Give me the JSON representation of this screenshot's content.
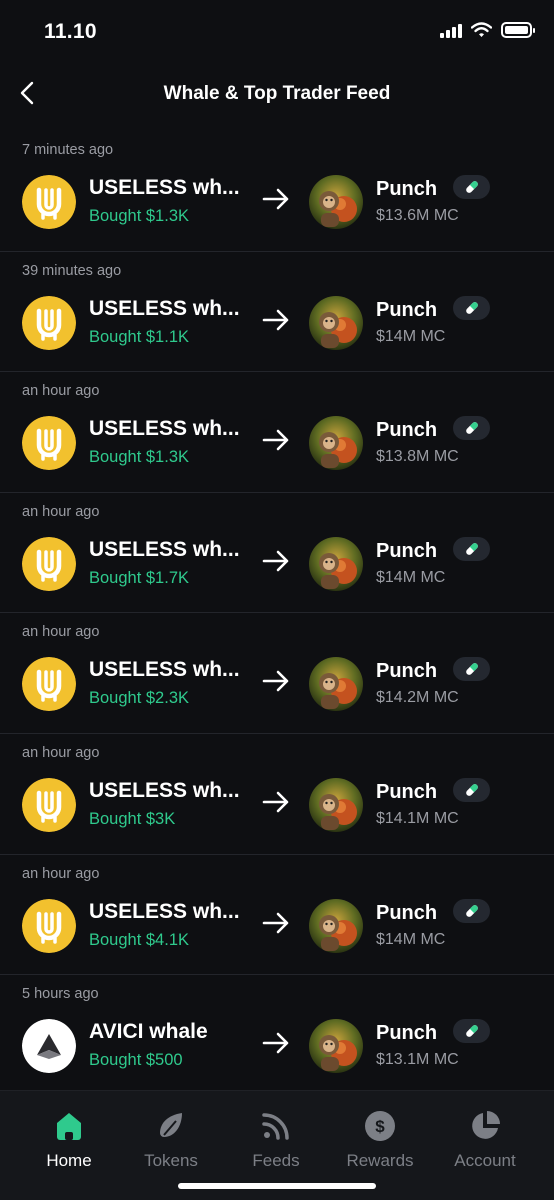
{
  "status_bar": {
    "time": "11.10"
  },
  "header": {
    "title": "Whale & Top Trader Feed"
  },
  "colors": {
    "accent_green": "#2fca8d",
    "useless_yellow": "#f2c12e",
    "background": "#0e0f12"
  },
  "feed": [
    {
      "time": "7 minutes ago",
      "trader": "USELESS wh...",
      "trader_icon": "useless-logo",
      "amount": "Bought $1.3K",
      "token": "Punch",
      "mc": "$13.6M MC"
    },
    {
      "time": "39 minutes ago",
      "trader": "USELESS wh...",
      "trader_icon": "useless-logo",
      "amount": "Bought $1.1K",
      "token": "Punch",
      "mc": "$14M MC"
    },
    {
      "time": "an hour ago",
      "trader": "USELESS wh...",
      "trader_icon": "useless-logo",
      "amount": "Bought $1.3K",
      "token": "Punch",
      "mc": "$13.8M MC"
    },
    {
      "time": "an hour ago",
      "trader": "USELESS wh...",
      "trader_icon": "useless-logo",
      "amount": "Bought $1.7K",
      "token": "Punch",
      "mc": "$14M MC"
    },
    {
      "time": "an hour ago",
      "trader": "USELESS wh...",
      "trader_icon": "useless-logo",
      "amount": "Bought $2.3K",
      "token": "Punch",
      "mc": "$14.2M MC"
    },
    {
      "time": "an hour ago",
      "trader": "USELESS wh...",
      "trader_icon": "useless-logo",
      "amount": "Bought $3K",
      "token": "Punch",
      "mc": "$14.1M MC"
    },
    {
      "time": "an hour ago",
      "trader": "USELESS wh...",
      "trader_icon": "useless-logo",
      "amount": "Bought $4.1K",
      "token": "Punch",
      "mc": "$14M MC"
    },
    {
      "time": "5 hours ago",
      "trader": "AVICI whale",
      "trader_icon": "avici-logo",
      "amount": "Bought $500",
      "token": "Punch",
      "mc": "$13.1M MC"
    }
  ],
  "nav": [
    {
      "label": "Home",
      "icon": "home-icon",
      "active": true
    },
    {
      "label": "Tokens",
      "icon": "tokens-icon",
      "active": false
    },
    {
      "label": "Feeds",
      "icon": "feeds-icon",
      "active": false
    },
    {
      "label": "Rewards",
      "icon": "rewards-icon",
      "active": false
    },
    {
      "label": "Account",
      "icon": "account-icon",
      "active": false
    }
  ]
}
